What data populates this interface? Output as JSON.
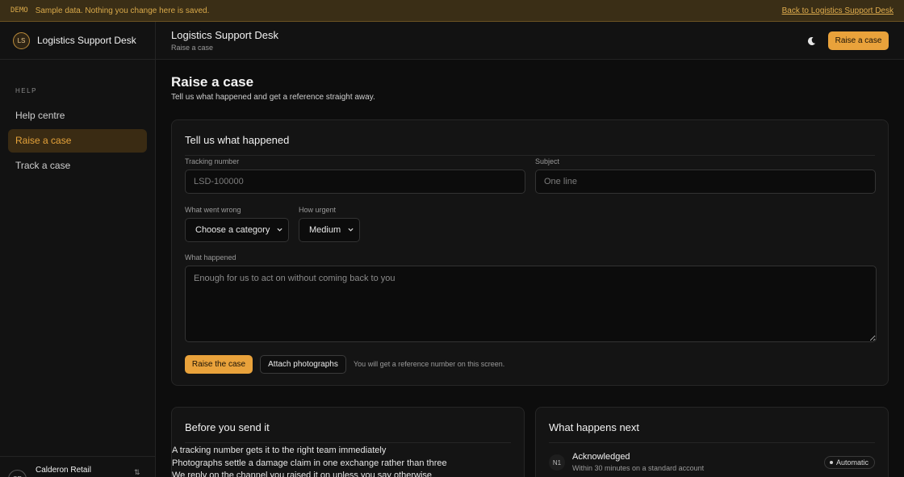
{
  "demo_bar": {
    "tag": "DEMO",
    "message": "Sample data. Nothing you change here is saved.",
    "back_link": "Back to Logistics Support Desk"
  },
  "sidebar": {
    "brand_initials": "LS",
    "brand_name": "Logistics Support Desk",
    "section": "HELP",
    "items": [
      {
        "label": "Help centre",
        "active": false
      },
      {
        "label": "Raise a case",
        "active": true
      },
      {
        "label": "Track a case",
        "active": false
      }
    ],
    "account": {
      "initials": "CR",
      "name": "Calderon Retail"
    }
  },
  "header": {
    "title": "Logistics Support Desk",
    "subtitle": "Raise a case",
    "cta": "Raise a case"
  },
  "main": {
    "title": "Raise a case",
    "description": "Tell us what happened and get a reference straight away."
  },
  "form": {
    "title": "Tell us what happened",
    "tracking": {
      "label": "Tracking number",
      "placeholder": "LSD-100000"
    },
    "subject": {
      "label": "Subject",
      "placeholder": "One line"
    },
    "category": {
      "label": "What went wrong",
      "value": "Choose a category"
    },
    "urgency": {
      "label": "How urgent",
      "value": "Medium"
    },
    "details": {
      "label": "What happened",
      "placeholder": "Enough for us to act on without coming back to you"
    },
    "submit": "Raise the case",
    "attach": "Attach photographs",
    "hint": "You will get a reference number on this screen."
  },
  "tips": {
    "title": "Before you send it",
    "items": [
      "A tracking number gets it to the right team immediately",
      "Photographs settle a damage claim in one exchange rather than three",
      "We reply on the channel you raised it on unless you say otherwise"
    ]
  },
  "next": {
    "title": "What happens next",
    "steps": [
      {
        "num": "N1",
        "title": "Acknowledged",
        "desc": "Within 30 minutes on a standard account",
        "badge": "Automatic"
      }
    ]
  },
  "colors": {
    "accent": "#e9a23b",
    "background": "#0d0d0d",
    "surface": "#141414"
  },
  "icons": {
    "theme": "moon-icon",
    "select": "chevron-down-icon"
  }
}
